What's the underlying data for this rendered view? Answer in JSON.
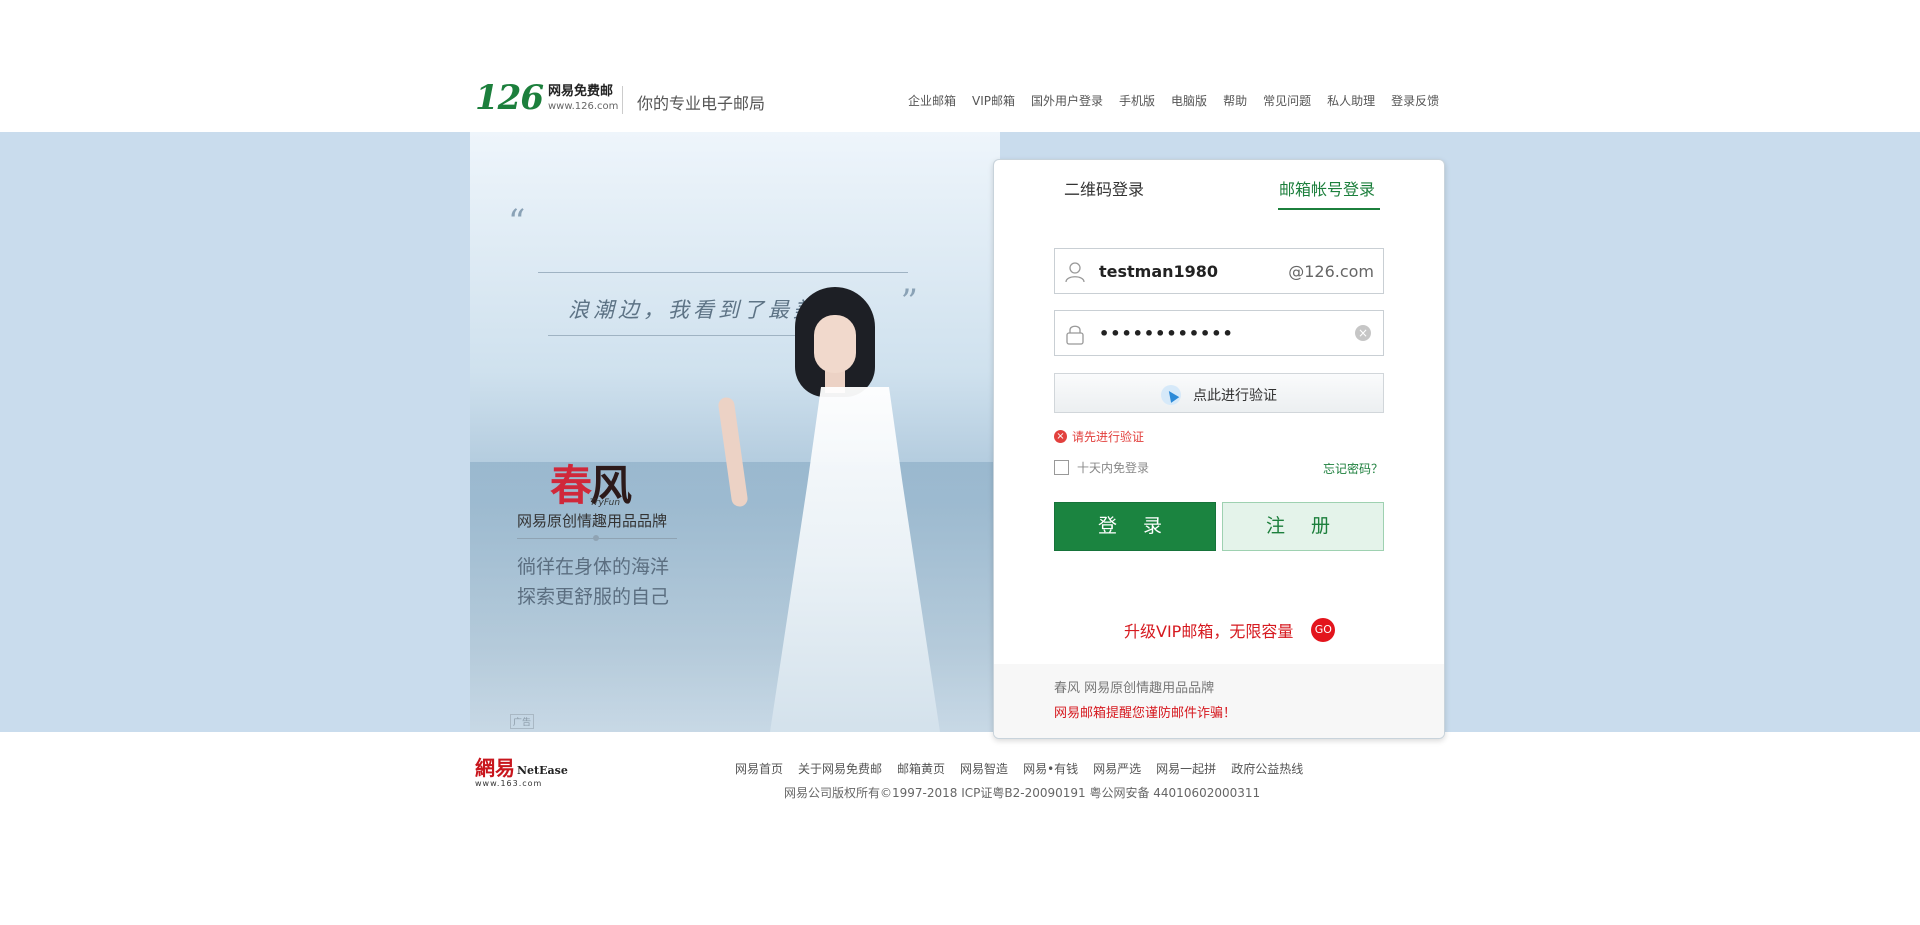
{
  "header": {
    "logo_number": "126",
    "logo_title": "网易免费邮",
    "logo_url": "www.126.com",
    "slogan": "你的专业电子邮局",
    "nav": [
      "企业邮箱",
      "VIP邮箱",
      "国外用户登录",
      "手机版",
      "电脑版",
      "帮助",
      "常见问题",
      "私人助理",
      "登录反馈"
    ]
  },
  "banner": {
    "quote": "浪潮边，我看到了最美的你",
    "brand_name_left": "春",
    "brand_name_right": "风",
    "brand_en": "TryFun",
    "brand_desc": "网易原创情趣用品品牌",
    "tagline_1": "徜徉在身体的海洋",
    "tagline_2": "探索更舒服的自己",
    "ad_tag": "广告"
  },
  "login": {
    "tab_qr": "二维码登录",
    "tab_account": "邮箱帐号登录",
    "username_value": "testman1980",
    "domain_suffix": "@126.com",
    "password_value": "••••••••••••",
    "verify_label": "点此进行验证",
    "error_text": "请先进行验证",
    "remember_label": "十天内免登录",
    "forgot_label": "忘记密码？",
    "login_button": "登 录",
    "register_button": "注 册",
    "vip_text": "升级VIP邮箱，无限容量",
    "vip_go": "GO",
    "notice_1": "春风 网易原创情趣用品品牌",
    "notice_2": "网易邮箱提醒您谨防邮件诈骗！"
  },
  "footer": {
    "logo_cn": "網易",
    "logo_en": "NetEase",
    "logo_url": "www.163.com",
    "links": [
      "网易首页",
      "关于网易免费邮",
      "邮箱黄页",
      "网易智造",
      "网易•有钱",
      "网易严选",
      "网易一起拼",
      "政府公益热线"
    ],
    "copyright": "网易公司版权所有©1997-2018   ICP证粤B2-20090191   粤公网安备 44010602000311"
  },
  "colors": {
    "brand_green": "#1c7f3c",
    "banner_bg": "#c9dced",
    "error_red": "#e2403d",
    "vip_red": "#d6191f"
  },
  "icons": [
    "user-icon",
    "lock-icon",
    "clear-icon",
    "cursor-icon",
    "error-icon"
  ]
}
